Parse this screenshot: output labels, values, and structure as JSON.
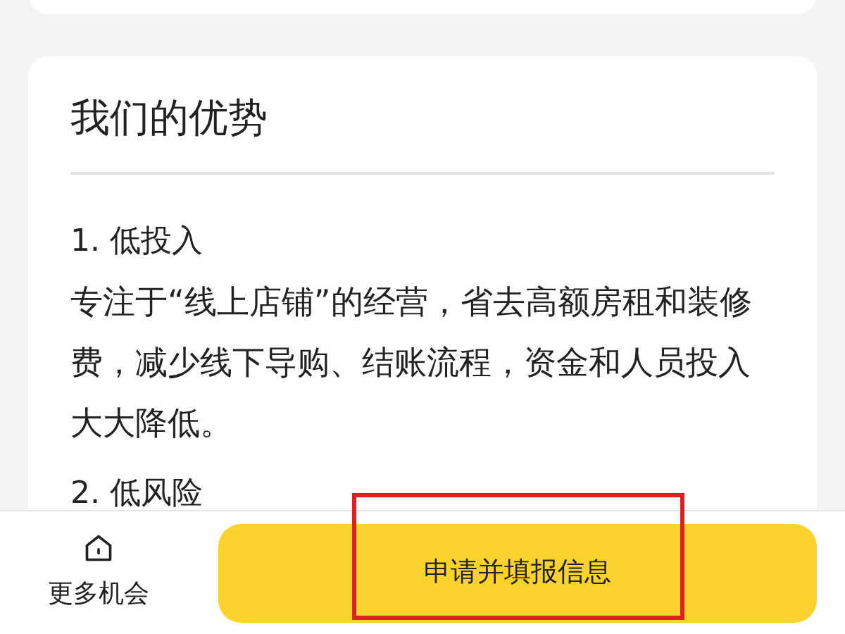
{
  "card": {
    "title": "我们的优势",
    "items": [
      {
        "heading": "1. 低投入",
        "body": "专注于“线上店铺”的经营，省去高额房租和装修费，减少线下导购、结账流程，资金和人员投入大大降低。"
      },
      {
        "heading": "2. 低风险"
      }
    ]
  },
  "bottom_bar": {
    "more_label": "更多机会",
    "apply_button": {
      "label": "申请并填报信息",
      "highlighted": true
    }
  }
}
